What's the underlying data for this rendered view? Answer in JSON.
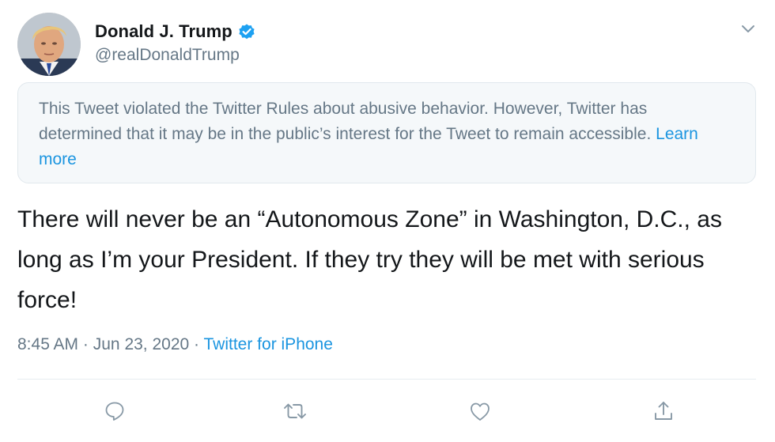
{
  "author": {
    "display_name": "Donald J. Trump",
    "handle": "@realDonaldTrump",
    "verified_icon": "verified-badge-icon"
  },
  "notice": {
    "text": "This Tweet violated the Twitter Rules about abusive behavior. However, Twitter has determined that it may be in the public’s interest for the Tweet to remain accessible.",
    "link_label": "Learn more"
  },
  "tweet": {
    "text": "There will never be an “Autonomous Zone” in Washington, D.C., as long as I’m your President. If they try they will be met with serious force!",
    "time": "8:45 AM",
    "date": "Jun 23, 2020",
    "separator": "·",
    "source": "Twitter for iPhone"
  },
  "actions": [
    {
      "icon": "reply-icon"
    },
    {
      "icon": "retweet-icon"
    },
    {
      "icon": "like-icon"
    },
    {
      "icon": "share-icon"
    }
  ],
  "colors": {
    "link": "#1b95e0",
    "secondary_text": "#657786",
    "notice_bg": "#f5f8fa",
    "verified": "#1da1f2",
    "action_icon": "#8899a6"
  }
}
